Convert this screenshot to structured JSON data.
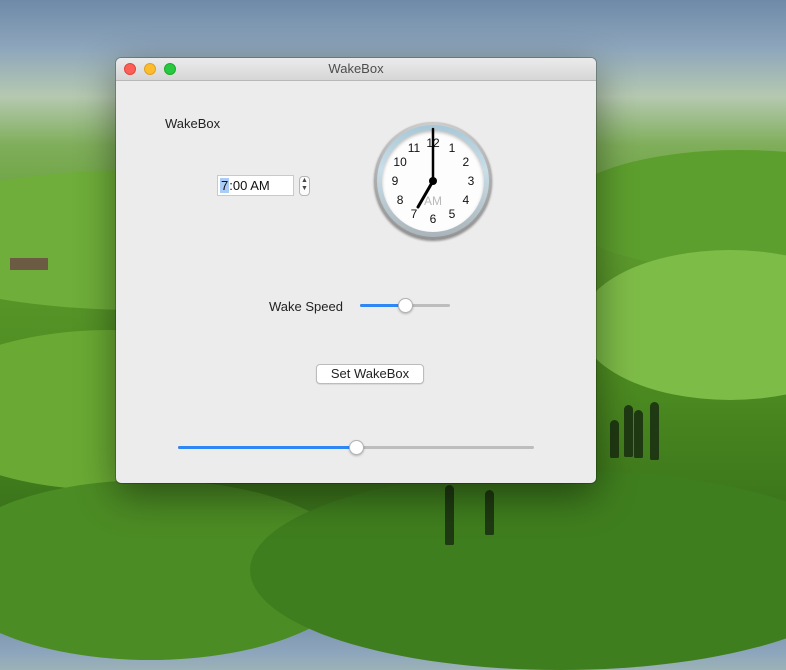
{
  "window": {
    "title": "WakeBox"
  },
  "app_label": "WakeBox",
  "time_picker": {
    "selected_part": "7",
    "rest": ":00 AM"
  },
  "clock": {
    "numbers": [
      "12",
      "1",
      "2",
      "3",
      "4",
      "5",
      "6",
      "7",
      "8",
      "9",
      "10",
      "11"
    ],
    "period": "AM",
    "hour": 7,
    "minute": 0
  },
  "wake_speed": {
    "label": "Wake Speed",
    "value_fraction": 0.5
  },
  "set_button": {
    "label": "Set WakeBox"
  },
  "bottom_slider": {
    "value_fraction": 0.5
  },
  "colors": {
    "accent": "#2f86f5",
    "window_bg": "#ececec"
  }
}
